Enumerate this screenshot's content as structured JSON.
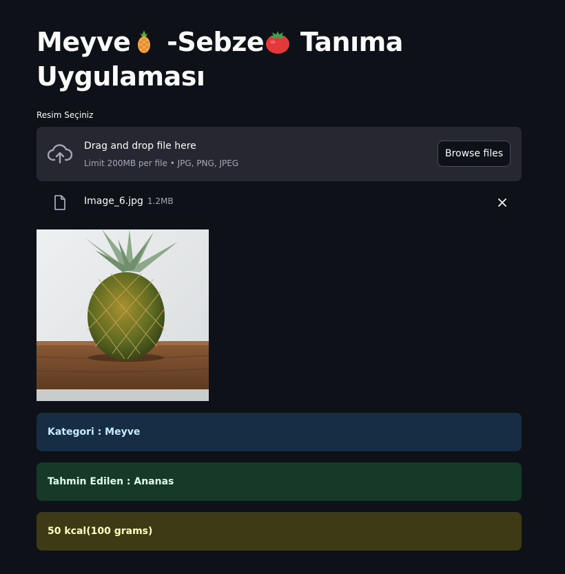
{
  "title": {
    "part1": "Meyve",
    "part2": " -Sebze",
    "part3": " Tanıma Uygulaması",
    "emoji1": "pineapple-icon",
    "emoji2": "tomato-icon"
  },
  "uploader": {
    "label": "Resim Seçiniz",
    "drop_text": "Drag and drop file here",
    "limit_text": "Limit 200MB per file • JPG, PNG, JPEG",
    "browse_label": "Browse files",
    "file_name": "Image_6.jpg",
    "file_size": "1.2MB"
  },
  "results": {
    "category": "Kategori : Meyve",
    "prediction": "Tahmin Edilen : Ananas",
    "calories": "50 kcal(100 grams)"
  },
  "colors": {
    "background": "#0e1117",
    "info": "#172d43",
    "success": "#173928",
    "warning": "#3e3a16"
  }
}
